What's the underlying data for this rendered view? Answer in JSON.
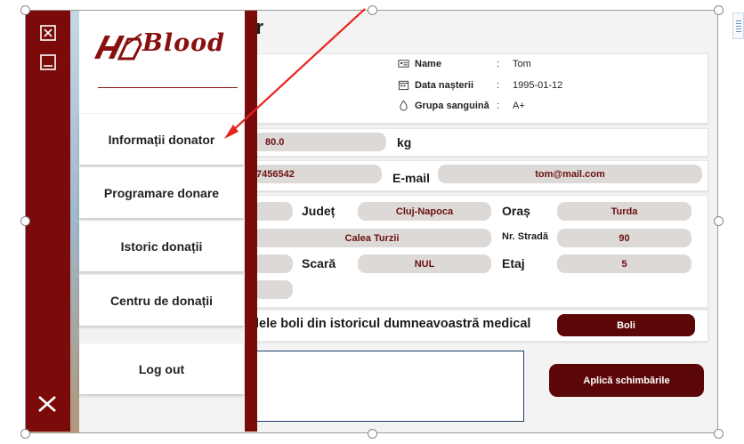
{
  "form": {
    "title_partial": "or",
    "profile": {
      "name_label": "Name",
      "name_value": "Tom",
      "dob_label": "Data nașterii",
      "dob_value": "1995-01-12",
      "blood_label": "Grupa sanguină",
      "blood_value": "A+",
      "colon": ":"
    },
    "weight_value": "80.0",
    "weight_unit": "kg",
    "phone_value": "7456542",
    "email_label": "E-mail",
    "email_value": "tom@mail.com",
    "address": {
      "county_label": "Județ",
      "county_value": "Cluj-Napoca",
      "city_label": "Oraș",
      "city_value": "Turda",
      "street_value": "Calea Turzii",
      "street_no_label": "Nr. Stradă",
      "street_no_value": "90",
      "stair_label": "Scară",
      "stair_value": "NUL",
      "floor_label": "Etaj",
      "floor_value": "5"
    },
    "diseases_text": "lele boli din istoricul dumneavoastră medical",
    "diseases_button": "Boli",
    "apply_button": "Aplică schimbările"
  },
  "menu": {
    "logo_text": "Blood",
    "items": [
      {
        "label": "Informații donator"
      },
      {
        "label": "Programare donare"
      },
      {
        "label": "Istoric donații"
      },
      {
        "label": "Centru de donații"
      },
      {
        "label": "Log out"
      }
    ]
  },
  "icons": {
    "close_window": "close-window-icon",
    "minimize": "minimize-icon",
    "close_menu": "close-menu-icon"
  },
  "colors": {
    "brand": "#7b0b0b",
    "button": "#5c0707",
    "field_bg": "#ddd9d6",
    "arrow": "#e8231d"
  }
}
